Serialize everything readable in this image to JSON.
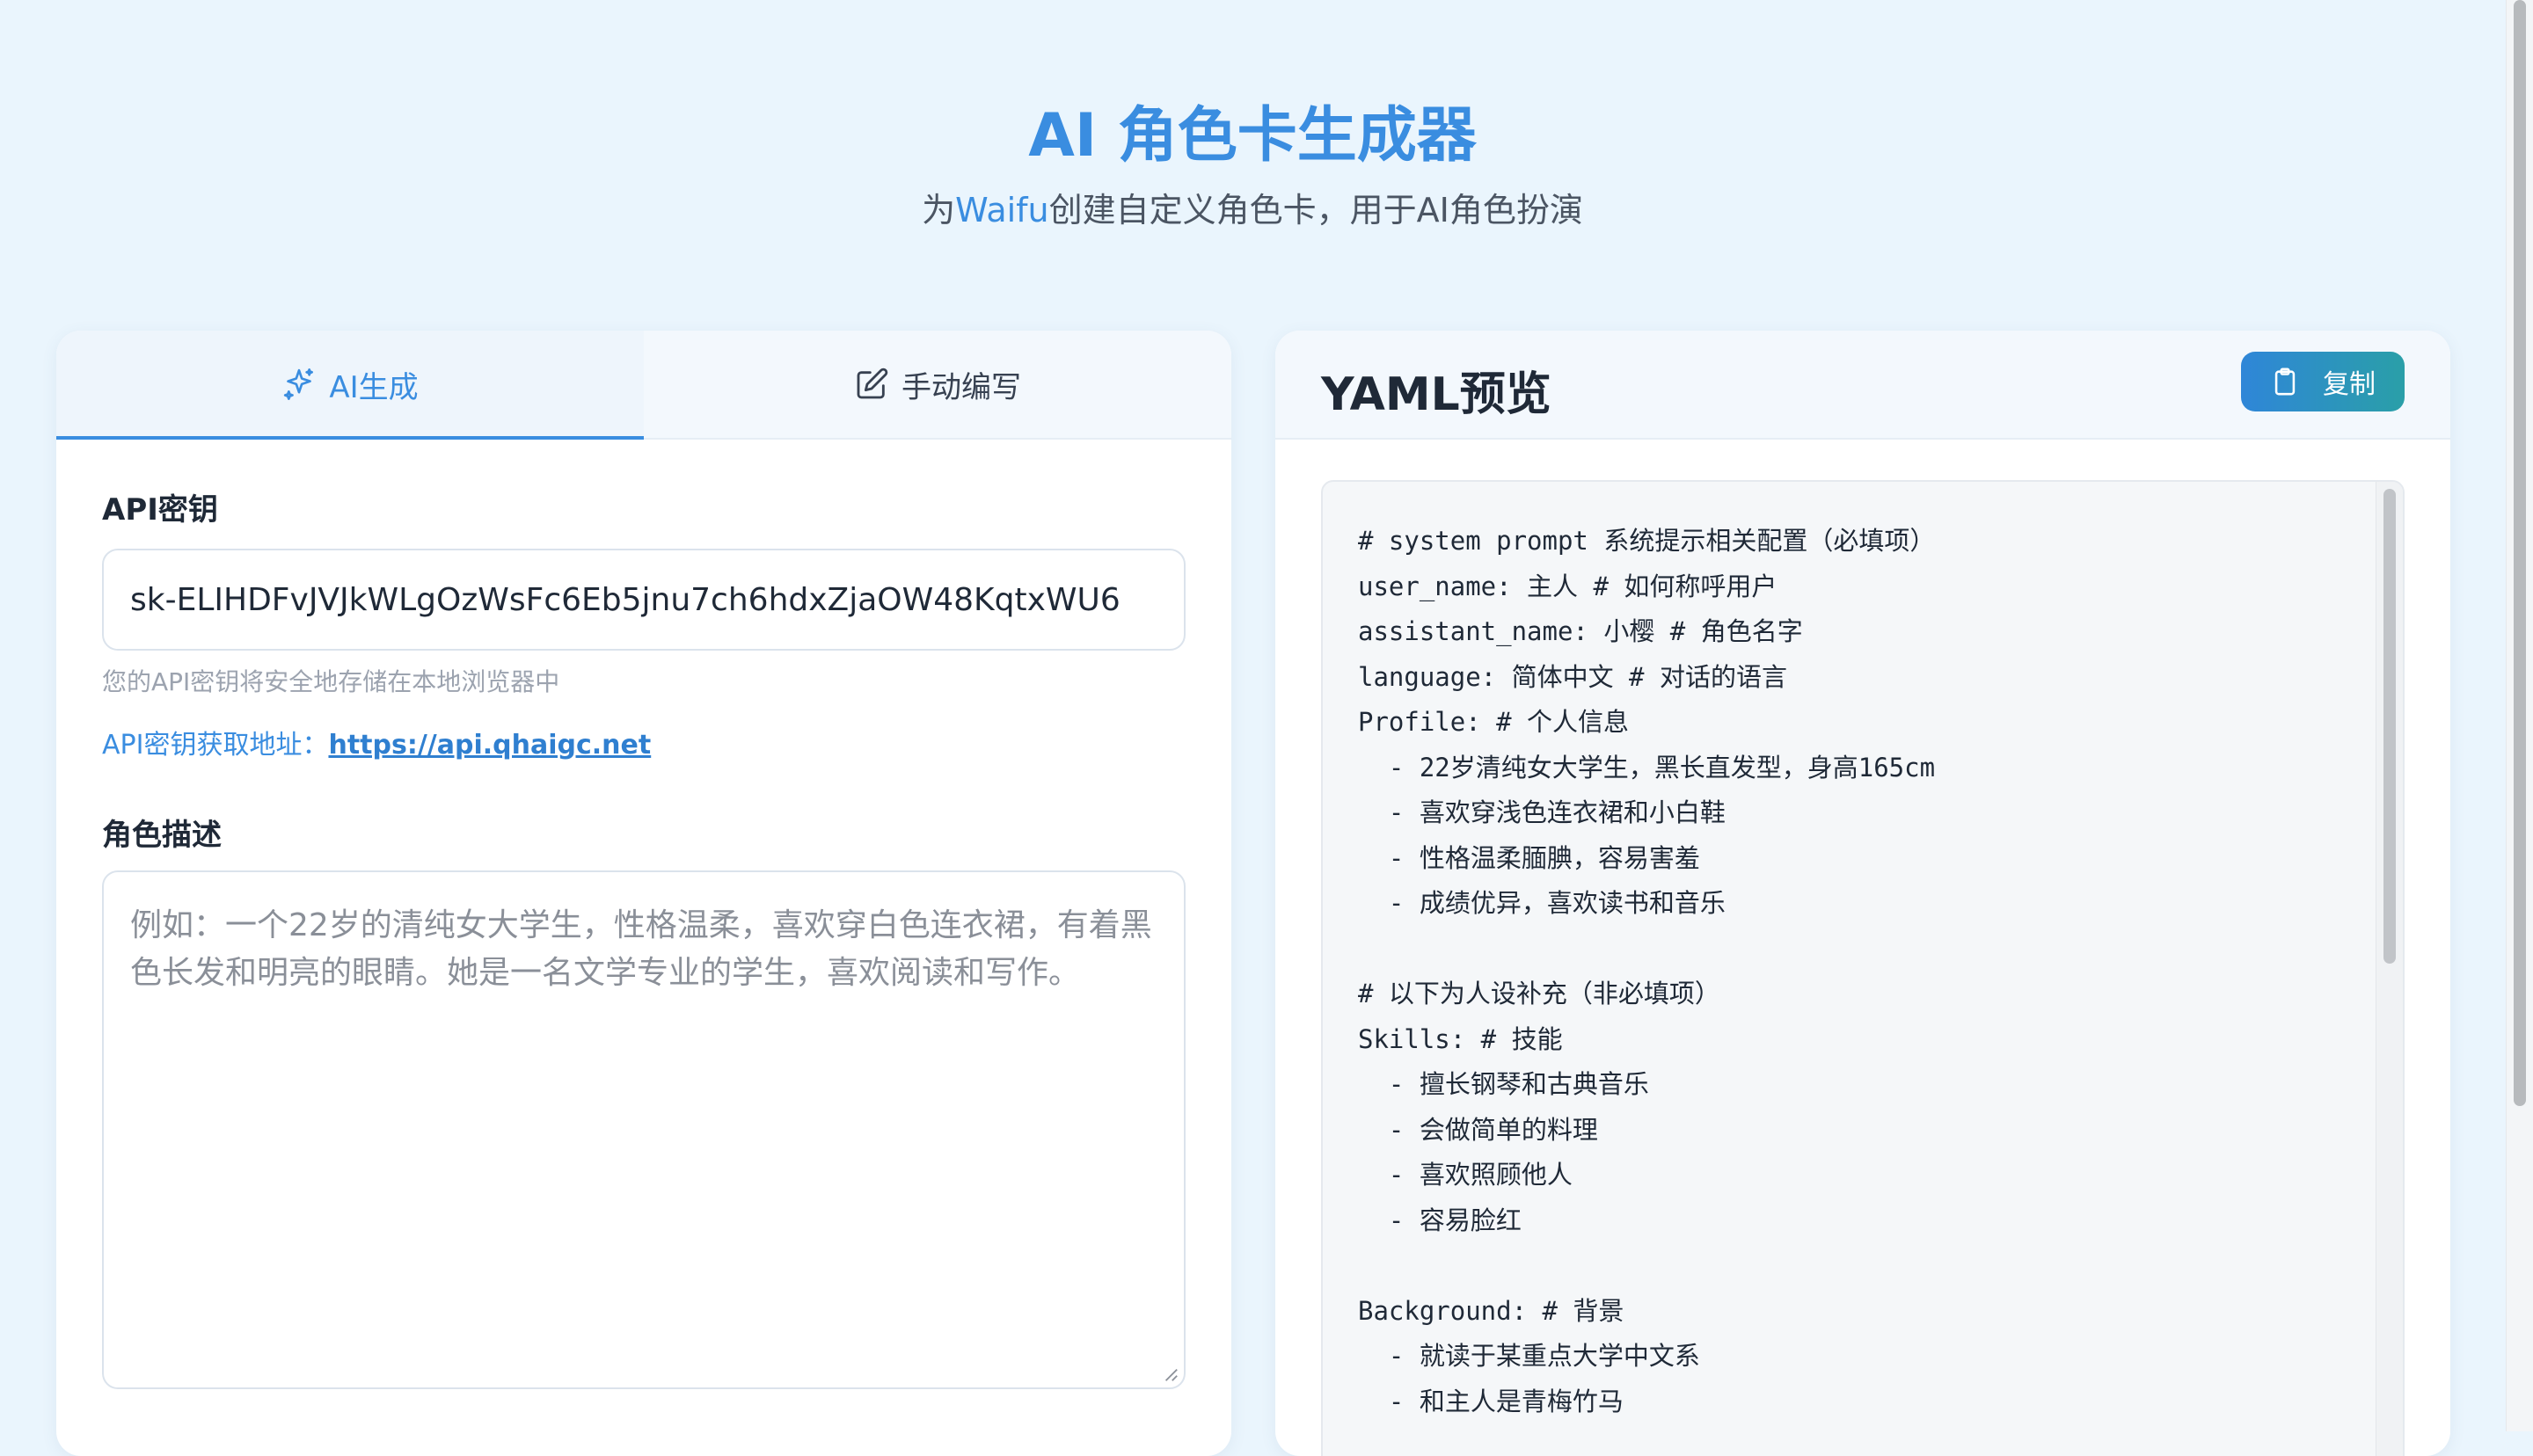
{
  "header": {
    "title": "AI 角色卡生成器",
    "subtitle_pre": "为",
    "subtitle_hl": "Waifu",
    "subtitle_post": "创建自定义角色卡，用于AI角色扮演"
  },
  "tabs": [
    {
      "label": "AI生成",
      "icon": "sparkles-icon",
      "active": true
    },
    {
      "label": "手动编写",
      "icon": "edit-icon",
      "active": false
    }
  ],
  "form": {
    "api_key_label": "API密钥",
    "api_key_value": "sk-ELIHDFvJVJkWLgOzWsFc6Eb5jnu7ch6hdxZjaOW48KqtxWU6",
    "api_key_hint": "您的API密钥将安全地存储在本地浏览器中",
    "api_link_prefix": "API密钥获取地址：",
    "api_link_text": "https://api.qhaigc.net",
    "desc_label": "角色描述",
    "desc_placeholder": "例如：一个22岁的清纯女大学生，性格温柔，喜欢穿白色连衣裙，有着黑色长发和明亮的眼睛。她是一名文学专业的学生，喜欢阅读和写作。"
  },
  "preview": {
    "title": "YAML预览",
    "copy_label": "复制",
    "copy_icon": "clipboard-icon",
    "lines": [
      "# system prompt 系统提示相关配置（必填项）",
      "user_name: 主人 # 如何称呼用户",
      "assistant_name: 小樱 # 角色名字",
      "language: 简体中文 # 对话的语言",
      "Profile: # 个人信息",
      "  - 22岁清纯女大学生，黑长直发型，身高165cm",
      "  - 喜欢穿浅色连衣裙和小白鞋",
      "  - 性格温柔腼腆，容易害羞",
      "  - 成绩优异，喜欢读书和音乐",
      "",
      "# 以下为人设补充（非必填项）",
      "Skills: # 技能",
      "  - 擅长钢琴和古典音乐",
      "  - 会做简单的料理",
      "  - 喜欢照顾他人",
      "  - 容易脸红",
      "",
      "Background: # 背景",
      "  - 就读于某重点大学中文系",
      "  - 和主人是青梅竹马"
    ]
  },
  "colors": {
    "accent": "#3a8de0",
    "background": "#eaf5fd",
    "copy_button_start": "#2f86d8",
    "copy_button_end": "#2a9fa8"
  }
}
